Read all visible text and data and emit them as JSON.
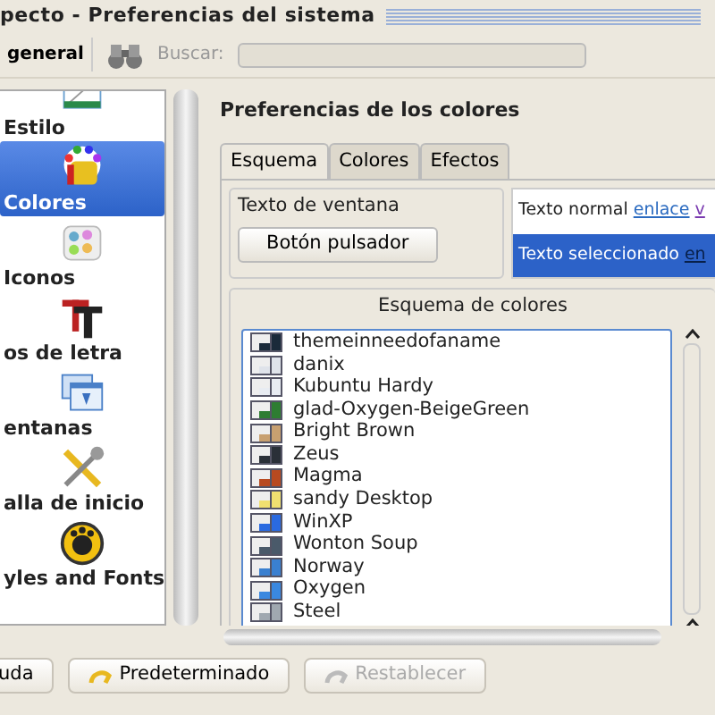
{
  "window": {
    "title": "pecto - Preferencias del sistema"
  },
  "toolbar": {
    "overview_button": "general",
    "search_label": "Buscar:"
  },
  "sidebar": {
    "items": [
      {
        "label": "Estilo",
        "kind": "style",
        "selected": false
      },
      {
        "label": "Colores",
        "kind": "colors",
        "selected": true
      },
      {
        "label": "Iconos",
        "kind": "icons",
        "selected": false
      },
      {
        "label": "os de letra",
        "kind": "fonts",
        "selected": false
      },
      {
        "label": "entanas",
        "kind": "windows",
        "selected": false
      },
      {
        "label": "alla de inicio",
        "kind": "tools",
        "selected": false
      },
      {
        "label": "yles and Fonts",
        "kind": "badge",
        "selected": false
      }
    ]
  },
  "page": {
    "heading": "Preferencias de los colores",
    "tabs": [
      {
        "label": "Esquema",
        "selected": true
      },
      {
        "label": "Colores",
        "selected": false
      },
      {
        "label": "Efectos",
        "selected": false
      }
    ],
    "preview": {
      "window_text": "Texto de ventana",
      "push_button": "Botón pulsador",
      "normal_text": "Texto normal",
      "link": "enlace",
      "visited_link": "v",
      "selected_text": "Texto seleccionado",
      "selected_link": "en"
    },
    "scheme_group": {
      "title": "Esquema de colores",
      "schemes": [
        {
          "name": "themeinneedofaname",
          "color": "#1a2a3a"
        },
        {
          "name": "danix",
          "color": "#dfe3ea"
        },
        {
          "name": "Kubuntu Hardy",
          "color": "#e8ecf2"
        },
        {
          "name": "glad-Oxygen-BeigeGreen",
          "color": "#2e7d32"
        },
        {
          "name": "Bright Brown",
          "color": "#c8a070"
        },
        {
          "name": "Zeus",
          "color": "#2a3038"
        },
        {
          "name": "Magma",
          "color": "#b84a20"
        },
        {
          "name": "sandy Desktop",
          "color": "#f0e070"
        },
        {
          "name": "WinXP",
          "color": "#2a6ae0"
        },
        {
          "name": "Wonton Soup",
          "color": "#4a5a6a"
        },
        {
          "name": "Norway",
          "color": "#3a80d0"
        },
        {
          "name": "Oxygen",
          "color": "#3a88e0"
        },
        {
          "name": "Steel",
          "color": "#a0a8b0"
        }
      ]
    }
  },
  "buttons": [
    {
      "label": "uda",
      "kind": "help",
      "disabled": false
    },
    {
      "label": "Predeterminado",
      "kind": "defaults",
      "disabled": false
    },
    {
      "label": "Restablecer",
      "kind": "reset",
      "disabled": true
    }
  ]
}
